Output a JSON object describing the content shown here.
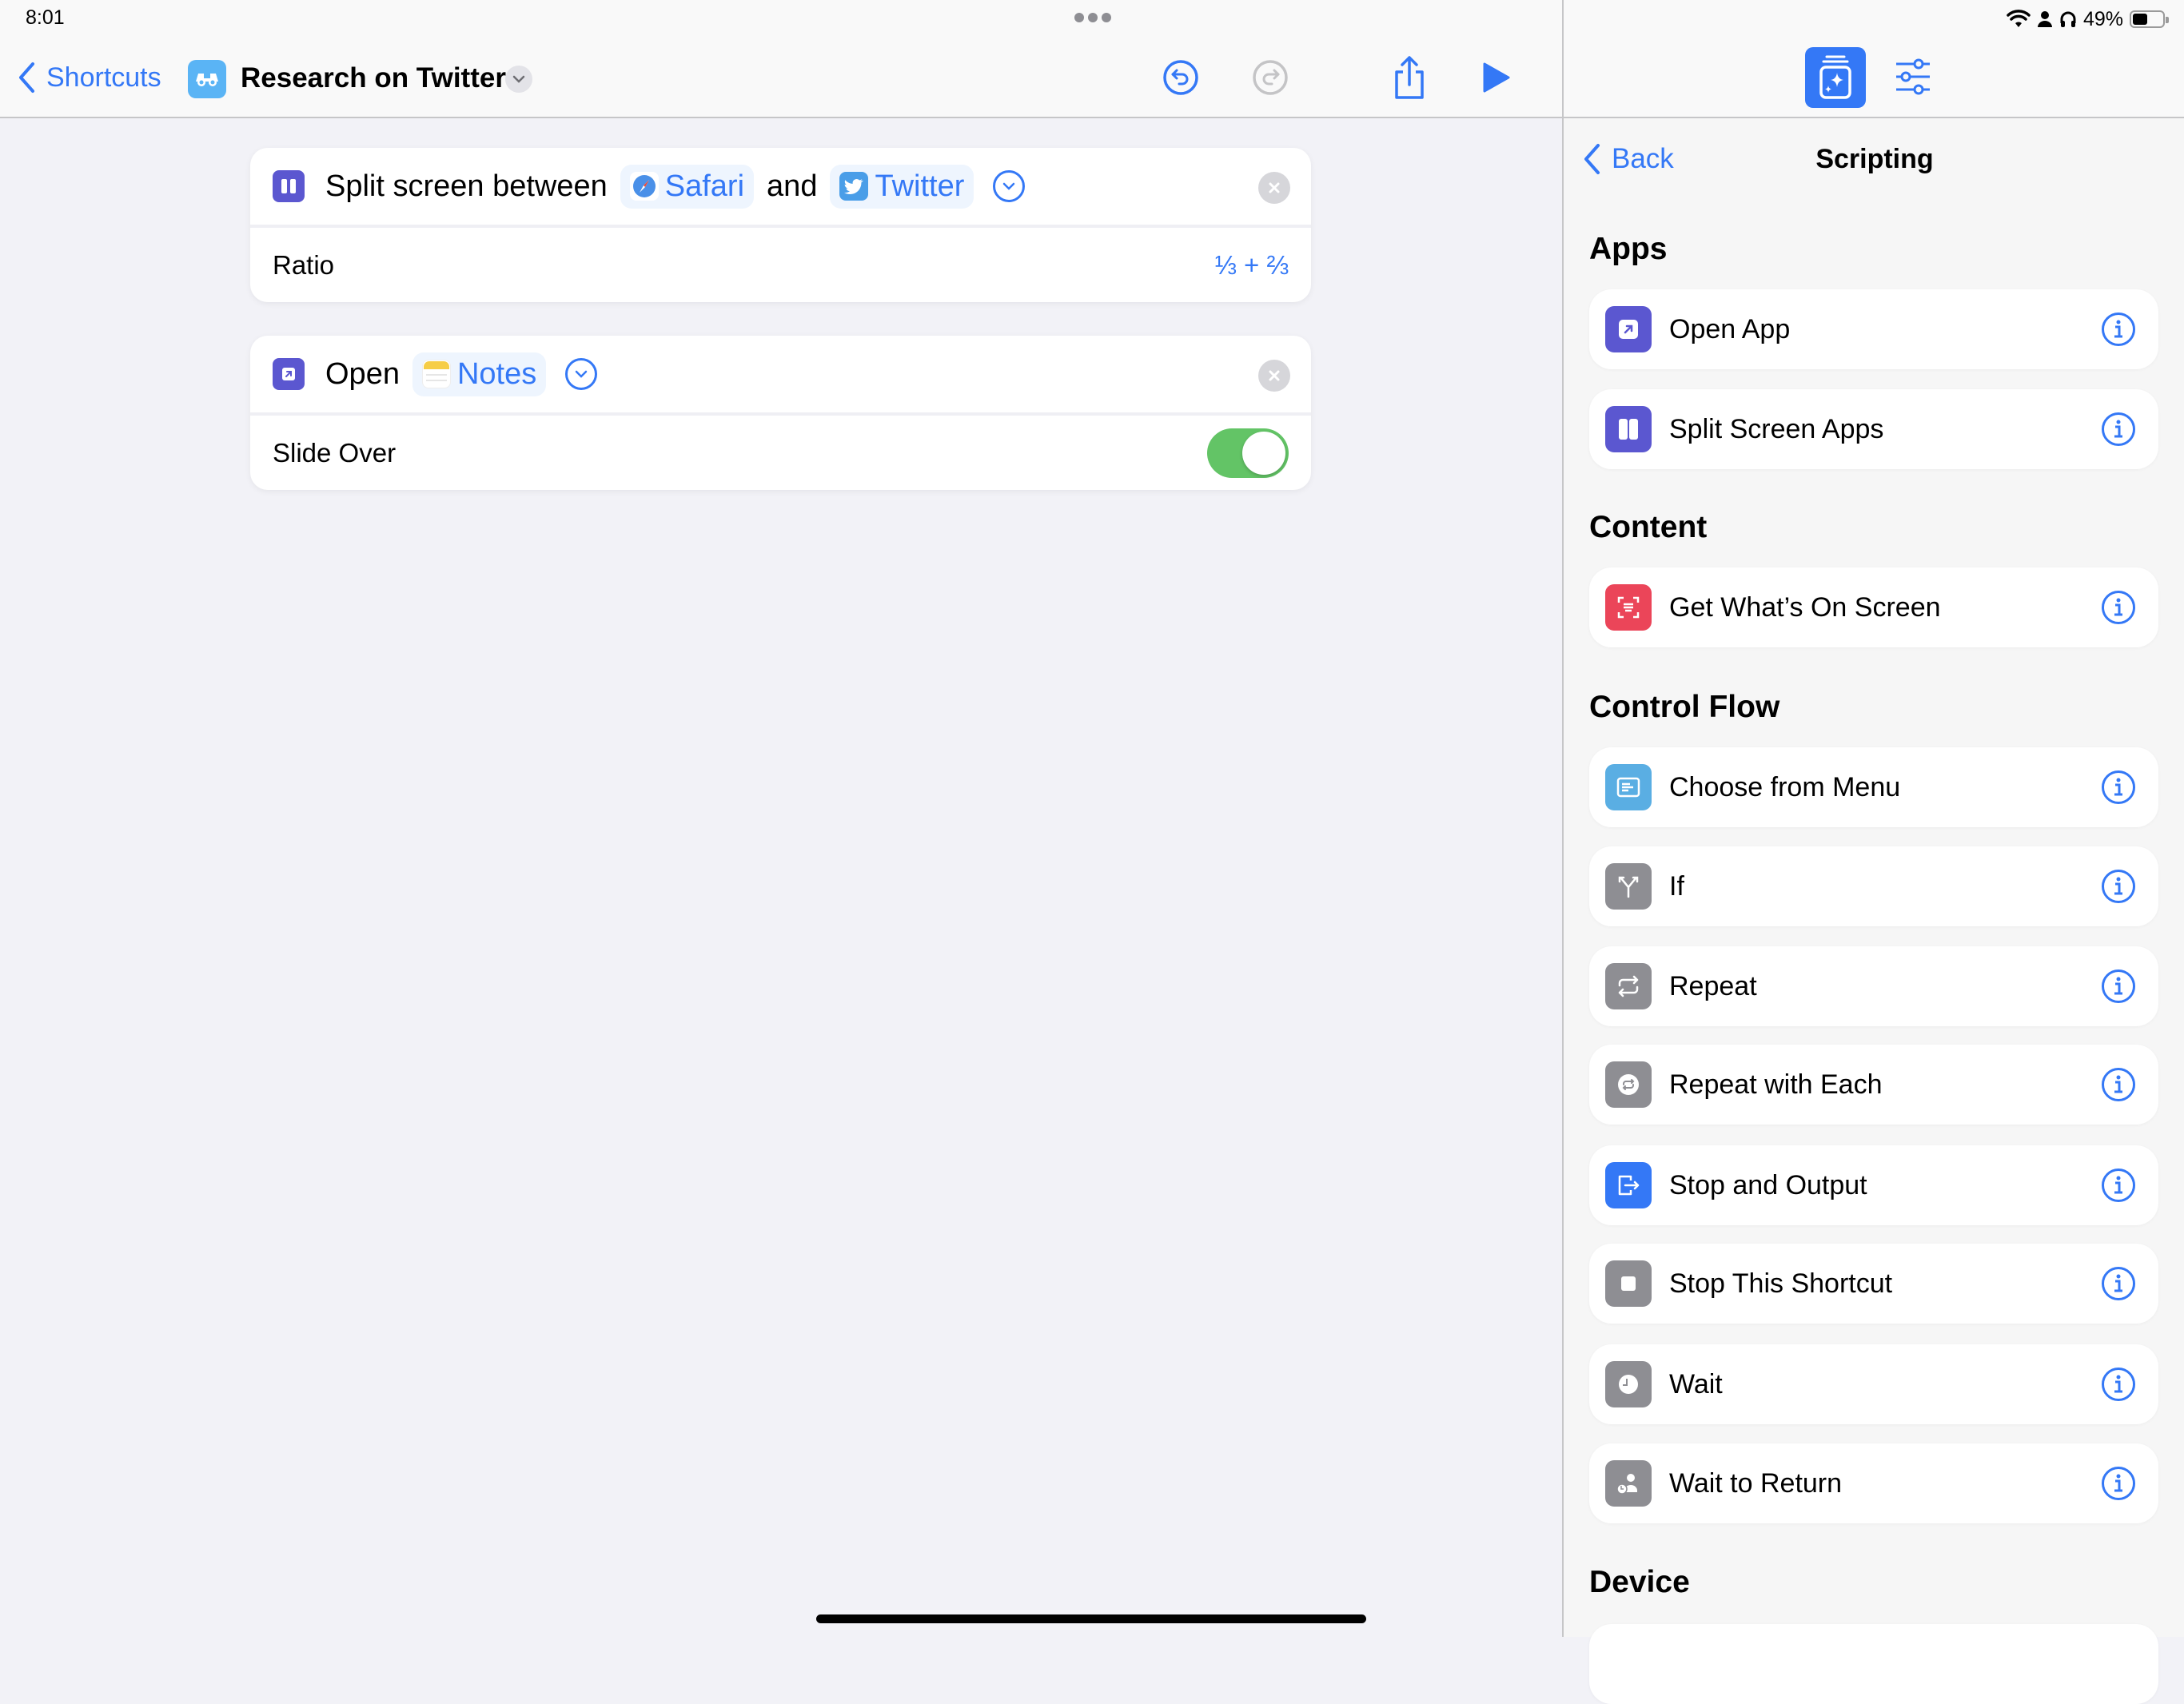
{
  "status_bar": {
    "time": "8:01",
    "battery_percent": "49%",
    "battery_level": 0.49,
    "icons": [
      "wifi-icon",
      "person-icon",
      "headphones-icon",
      "battery-icon"
    ]
  },
  "header": {
    "back_label": "Shortcuts",
    "shortcut_icon": "binoculars-icon",
    "title": "Research on Twitter",
    "buttons": [
      "undo",
      "redo",
      "share",
      "run"
    ]
  },
  "editor": {
    "actions": [
      {
        "verb": "Split screen between",
        "connector": "and",
        "app1": "Safari",
        "app2": "Twitter",
        "param_label": "Ratio",
        "param_value": "⅓ + ⅔"
      },
      {
        "verb": "Open",
        "app": "Notes",
        "param_label": "Slide Over",
        "param_toggle_on": true
      }
    ]
  },
  "panel": {
    "back_label": "Back",
    "title": "Scripting",
    "sections": [
      {
        "title": "Apps",
        "items": [
          {
            "label": "Open App",
            "icon": "open-app-icon",
            "color": "#5b57d0"
          },
          {
            "label": "Split Screen Apps",
            "icon": "split-screen-icon",
            "color": "#5b57d0"
          }
        ]
      },
      {
        "title": "Content",
        "items": [
          {
            "label": "Get What’s On Screen",
            "icon": "screen-scan-icon",
            "color": "#eb4559"
          }
        ]
      },
      {
        "title": "Control Flow",
        "items": [
          {
            "label": "Choose from Menu",
            "icon": "menu-icon",
            "color": "#5aaee3"
          },
          {
            "label": "If",
            "icon": "branch-icon",
            "color": "#8e8e93"
          },
          {
            "label": "Repeat",
            "icon": "repeat-icon",
            "color": "#8e8e93"
          },
          {
            "label": "Repeat with Each",
            "icon": "repeat-circle-icon",
            "color": "#8e8e93"
          },
          {
            "label": "Stop and Output",
            "icon": "exit-icon",
            "color": "#3478f6"
          },
          {
            "label": "Stop This Shortcut",
            "icon": "stop-icon",
            "color": "#8e8e93"
          },
          {
            "label": "Wait",
            "icon": "clock-icon",
            "color": "#8e8e93"
          },
          {
            "label": "Wait to Return",
            "icon": "person-clock-icon",
            "color": "#8e8e93"
          }
        ]
      },
      {
        "title": "Device",
        "items": []
      }
    ]
  },
  "colors": {
    "accent": "#3478f6",
    "toggle_on": "#63c466",
    "action_purple": "#5b57d0"
  }
}
